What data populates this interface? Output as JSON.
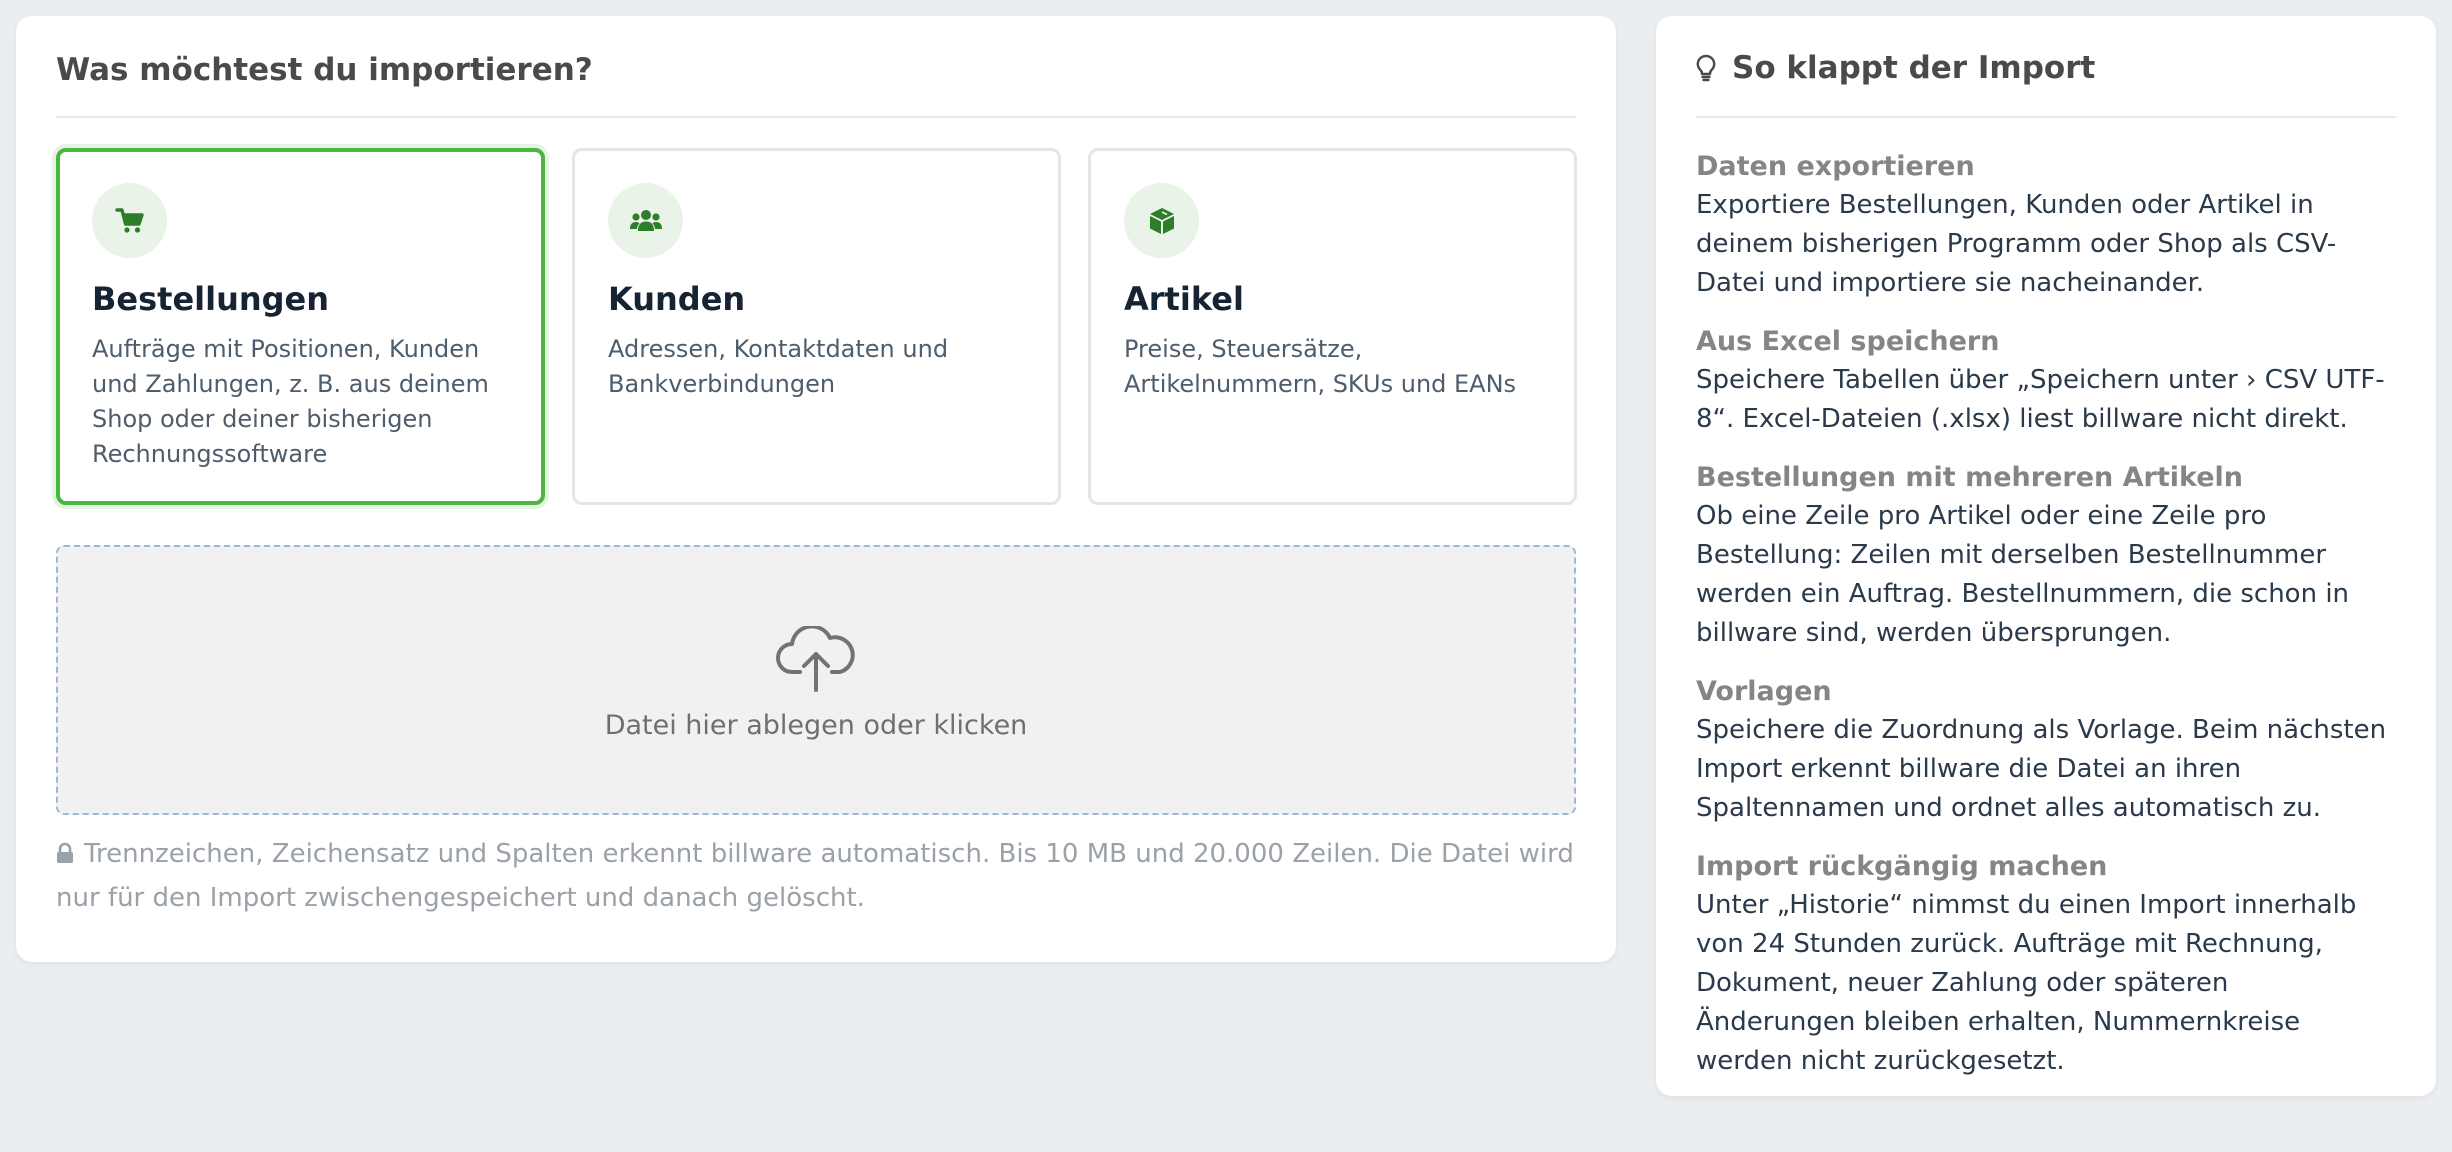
{
  "importer": {
    "title": "Was möchtest du importieren?",
    "types": [
      {
        "title": "Bestellungen",
        "description": "Aufträge mit Positionen, Kunden und Zahlungen, z. B. aus deinem Shop oder deiner bisherigen Rechnungssoftware",
        "icon": "cart-icon",
        "selected": true
      },
      {
        "title": "Kunden",
        "description": "Adressen, Kontaktdaten und Bankverbindungen",
        "icon": "users-icon",
        "selected": false
      },
      {
        "title": "Artikel",
        "description": "Preise, Steuersätze, Artikelnummern, SKUs und EANs",
        "icon": "box-icon",
        "selected": false
      }
    ],
    "dropzone": {
      "label": "Datei hier ablegen oder klicken",
      "icon": "cloud-upload-icon"
    },
    "note": "Trennzeichen, Zeichensatz und Spalten erkennt billware automatisch. Bis 10 MB und 20.000 Zeilen. Die Datei wird nur für den Import zwischengespeichert und danach gelöscht.",
    "note_icon": "lock-icon"
  },
  "help": {
    "title": "So klappt der Import",
    "icon": "lightbulb-icon",
    "steps": [
      {
        "title": "Daten exportieren",
        "text": "Exportiere Bestellungen, Kunden oder Artikel in deinem bisherigen Programm oder Shop als CSV-Datei und importiere sie nacheinander."
      },
      {
        "title": "Aus Excel speichern",
        "text": "Speichere Tabellen über „Speichern unter › CSV UTF-8“. Excel-Dateien (.xlsx) liest billware nicht direkt."
      },
      {
        "title": "Bestellungen mit mehreren Artikeln",
        "text": "Ob eine Zeile pro Artikel oder eine Zeile pro Bestellung: Zeilen mit derselben Bestellnummer werden ein Auftrag. Bestellnummern, die schon in billware sind, werden übersprungen."
      },
      {
        "title": "Vorlagen",
        "text": "Speichere die Zuordnung als Vorlage. Beim nächsten Import erkennt billware die Datei an ihren Spaltennamen und ordnet alles automatisch zu."
      },
      {
        "title": "Import rückgängig machen",
        "text": "Unter „Historie“ nimmst du einen Import innerhalb von 24 Stunden zurück. Aufträge mit Rechnung, Dokument, neuer Zahlung oder späteren Änderungen bleiben erhalten, Nummernkreise werden nicht zurückgesetzt."
      }
    ]
  },
  "colors": {
    "accent": "#4cb540",
    "icon_green": "#2e7d2a",
    "page_background": "#ebeef1",
    "dropzone_border": "#9bb8d6"
  }
}
